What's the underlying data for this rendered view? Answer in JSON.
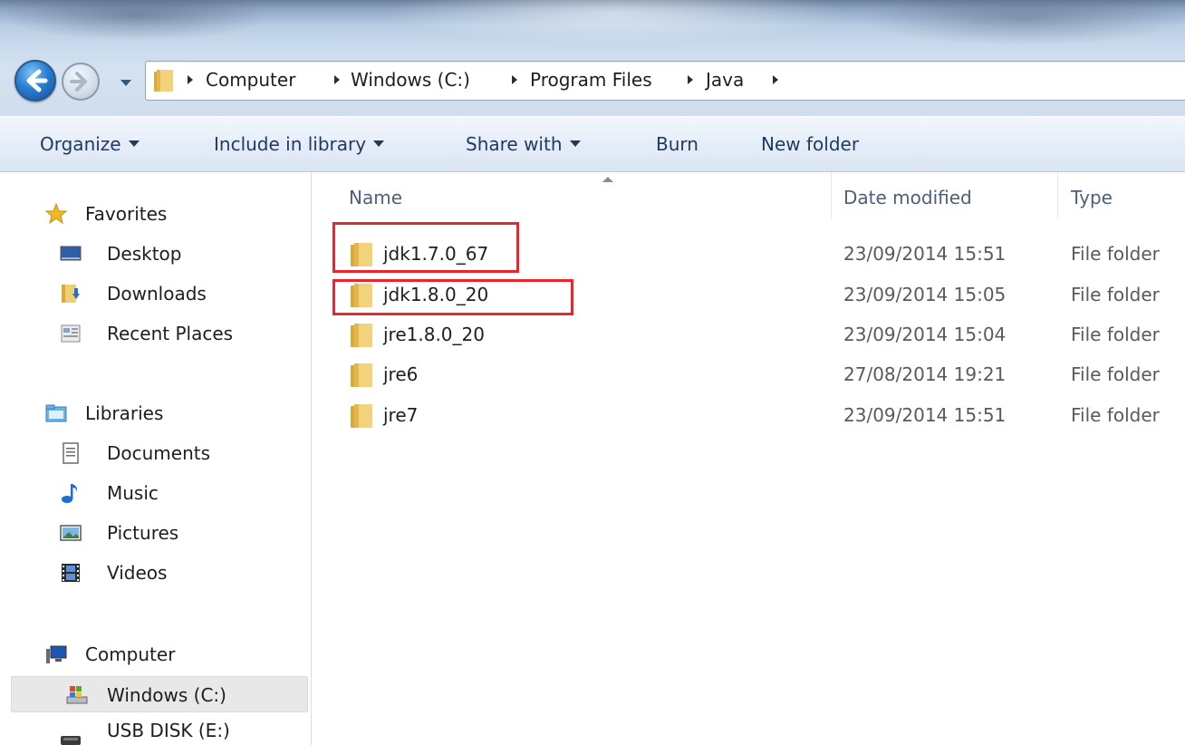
{
  "address": {
    "breadcrumbs": [
      "Computer",
      "Windows (C:)",
      "Program Files",
      "Java"
    ]
  },
  "toolbar": {
    "organize": "Organize",
    "include_in_library": "Include in library",
    "share_with": "Share with",
    "burn": "Burn",
    "new_folder": "New folder"
  },
  "sidebar": {
    "favorites": "Favorites",
    "desktop": "Desktop",
    "downloads": "Downloads",
    "recent_places": "Recent Places",
    "libraries": "Libraries",
    "documents": "Documents",
    "music": "Music",
    "pictures": "Pictures",
    "videos": "Videos",
    "computer": "Computer",
    "windows_c": "Windows (C:)",
    "usb_disk": "USB DISK (E:)"
  },
  "columns": {
    "name": "Name",
    "date_modified": "Date modified",
    "type": "Type"
  },
  "files": [
    {
      "name": "jdk1.7.0_67",
      "date": "23/09/2014 15:51",
      "type": "File folder"
    },
    {
      "name": "jdk1.8.0_20",
      "date": "23/09/2014 15:05",
      "type": "File folder"
    },
    {
      "name": "jre1.8.0_20",
      "date": "23/09/2014 15:04",
      "type": "File folder"
    },
    {
      "name": "jre6",
      "date": "27/08/2014 19:21",
      "type": "File folder"
    },
    {
      "name": "jre7",
      "date": "23/09/2014 15:51",
      "type": "File folder"
    }
  ],
  "colors": {
    "highlight": "#e8262d",
    "folder": "#e8c25a",
    "selected_nav": "#e8e8e8"
  }
}
